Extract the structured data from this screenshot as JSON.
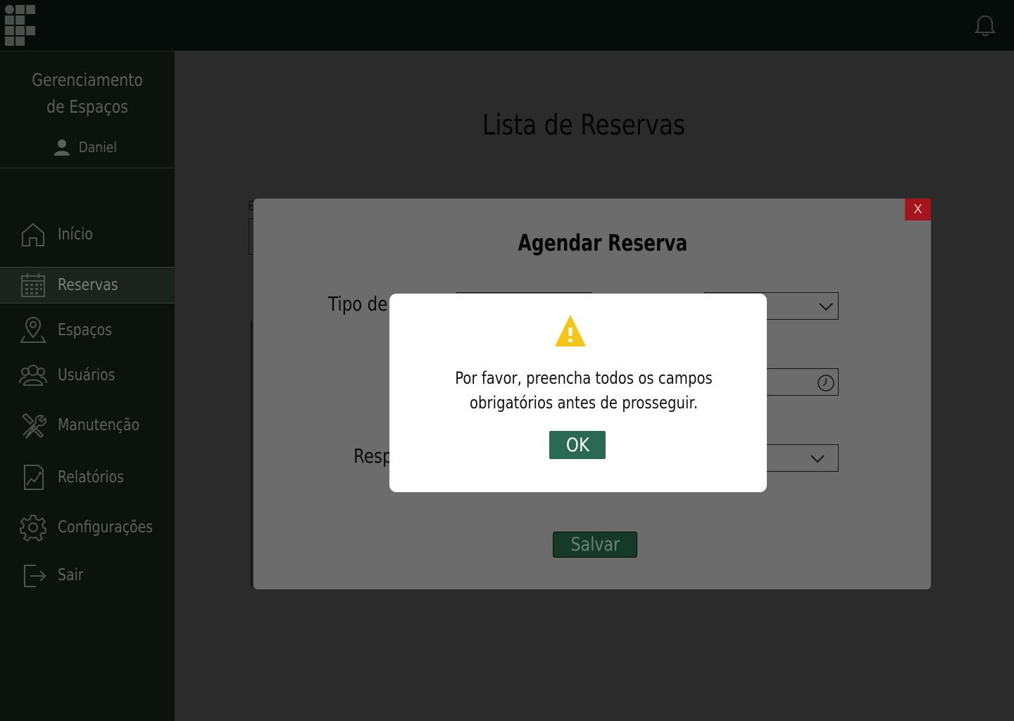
{
  "app": {
    "brand_line1": "Gerenciamento",
    "brand_line2": "de Espaços",
    "user_name": "Daniel"
  },
  "sidebar": {
    "items": [
      {
        "label": "Início",
        "icon": "home-icon"
      },
      {
        "label": "Reservas",
        "icon": "calendar-icon",
        "active": true
      },
      {
        "label": "Espaços",
        "icon": "map-pin-icon"
      },
      {
        "label": "Usuários",
        "icon": "users-icon"
      },
      {
        "label": "Manutenção",
        "icon": "tools-icon"
      },
      {
        "label": "Relatórios",
        "icon": "report-chart-icon"
      },
      {
        "label": "Configurações",
        "icon": "gear-icon"
      },
      {
        "label": "Sair",
        "icon": "logout-icon"
      }
    ]
  },
  "main": {
    "title": "Lista de Reservas",
    "bg_fragment": "E"
  },
  "modal": {
    "title": "Agendar Reserva",
    "close_label": "X",
    "field_tipo_label": "Tipo de",
    "field_resp_label": "Resp",
    "save_label": "Salvar"
  },
  "alert": {
    "icon": "warning-icon",
    "message_line1": "Por favor, preencha todos os campos",
    "message_line2": "obrigatórios antes de prosseguir.",
    "ok_label": "OK"
  },
  "colors": {
    "topbar": "#060c09",
    "sidebar": "#0c130f",
    "accent_green": "#2a6a52",
    "close_red": "#a3141c",
    "warning_yellow": "#f5c518"
  }
}
